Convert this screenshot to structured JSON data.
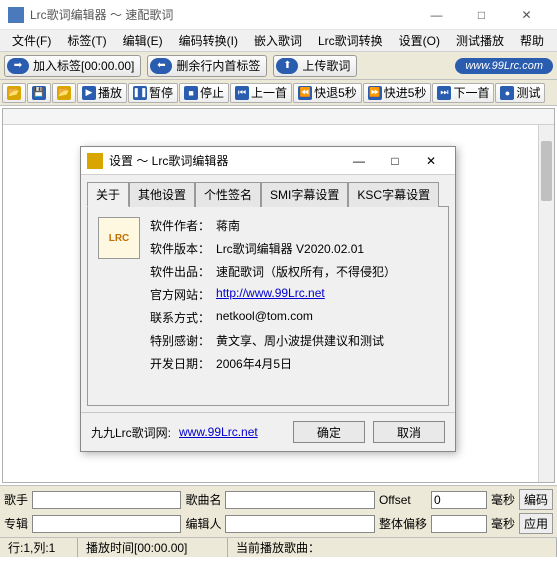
{
  "window": {
    "title": "Lrc歌词编辑器 ～ 速配歌词",
    "min": "—",
    "max": "□",
    "close": "✕"
  },
  "menu": [
    "文件(F)",
    "标签(T)",
    "编辑(E)",
    "编码转换(I)",
    "嵌入歌词",
    "Lrc歌词转换",
    "设置(O)",
    "测试播放",
    "帮助"
  ],
  "toolbar1": {
    "add_tag": "加入标签[00:00.00]",
    "del_first": "删余行内首标签",
    "upload": "上传歌词",
    "logo": "www.99Lrc.com"
  },
  "toolbar2": [
    {
      "ico": "📂",
      "cls": "y",
      "label": ""
    },
    {
      "ico": "💾",
      "cls": "",
      "label": ""
    },
    {
      "ico": "📂",
      "cls": "y",
      "label": ""
    },
    {
      "ico": "▶",
      "cls": "",
      "label": "播放"
    },
    {
      "ico": "❚❚",
      "cls": "",
      "label": "暂停"
    },
    {
      "ico": "■",
      "cls": "",
      "label": "停止"
    },
    {
      "ico": "⏮",
      "cls": "",
      "label": "上一首"
    },
    {
      "ico": "⏪",
      "cls": "",
      "label": "快退5秒"
    },
    {
      "ico": "⏩",
      "cls": "",
      "label": "快进5秒"
    },
    {
      "ico": "⏭",
      "cls": "",
      "label": "下一首"
    },
    {
      "ico": "●",
      "cls": "",
      "label": "测试"
    }
  ],
  "fields": {
    "singer_label": "歌手",
    "singer": "",
    "song_label": "歌曲名",
    "song": "",
    "offset_label": "Offset",
    "offset": "0",
    "offset_unit": "毫秒",
    "offset_btn": "编码",
    "album_label": "专辑",
    "album": "",
    "editor_label": "编辑人",
    "editor": "",
    "global_offset_label": "整体偏移",
    "global_offset": "",
    "global_unit": "毫秒",
    "global_btn": "应用"
  },
  "status": {
    "pos": "行:1,列:1",
    "playtime": "播放时间[00:00.00]",
    "nowplaying": "当前播放歌曲："
  },
  "dialog": {
    "title": "设置 ～ Lrc歌词编辑器",
    "min": "—",
    "max": "□",
    "close": "✕",
    "tabs": [
      "关于",
      "其他设置",
      "个性签名",
      "SMI字幕设置",
      "KSC字幕设置"
    ],
    "lrc_icon": "LRC",
    "rows": [
      {
        "k": "软件作者：",
        "v": "蒋南"
      },
      {
        "k": "软件版本：",
        "v": "Lrc歌词编辑器 V2020.02.01"
      },
      {
        "k": "软件出品：",
        "v": "速配歌词（版权所有，不得侵犯）"
      },
      {
        "k": "官方网站：",
        "v": "http://www.99Lrc.net",
        "link": true
      },
      {
        "k": "联系方式：",
        "v": "netkool@tom.com"
      },
      {
        "k": "特别感谢：",
        "v": "黄文享、周小波提供建议和测试"
      },
      {
        "k": "开发日期：",
        "v": "2006年4月5日"
      }
    ],
    "bottom_label": "九九Lrc歌词网:",
    "bottom_link": "www.99Lrc.net",
    "ok": "确定",
    "cancel": "取消"
  }
}
